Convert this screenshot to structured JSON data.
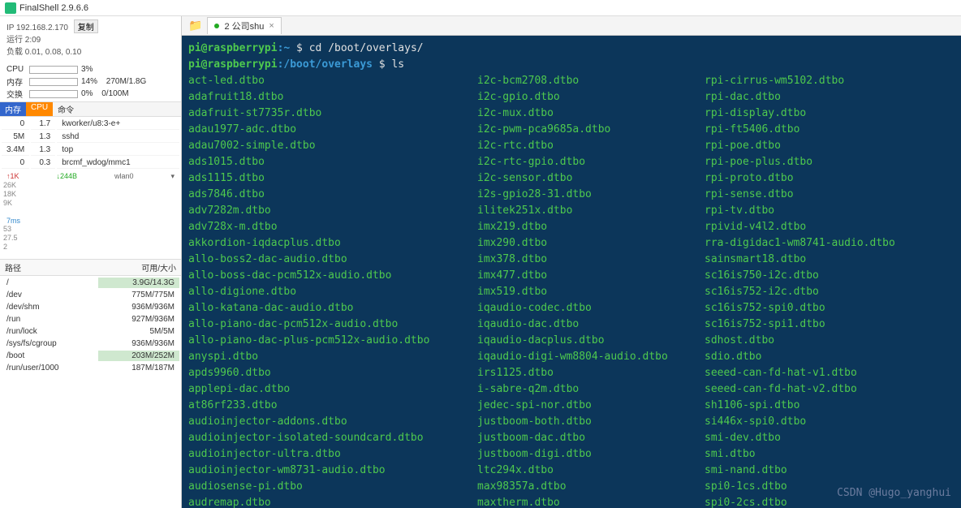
{
  "app": {
    "title": "FinalShell 2.9.6.6"
  },
  "sidebar": {
    "ip_line": "IP 192.168.2.170",
    "copy_label": "复制",
    "run_line": "运行 2:09",
    "load_line": "负载 0.01, 0.08, 0.10",
    "gauges": {
      "cpu_label": "CPU",
      "cpu_pct": "3%",
      "cpu_fill": 3,
      "mem_label": "内存",
      "mem_pct": "14%",
      "mem_text": "270M/1.8G",
      "mem_fill": 14,
      "swap_label": "交换",
      "swap_pct": "0%",
      "swap_text": "0/100M",
      "swap_fill": 0
    },
    "proc_headers": [
      "内存",
      "CPU",
      "命令"
    ],
    "procs": [
      {
        "mem": "0",
        "cpu": "1.7",
        "cmd": "kworker/u8:3-e+"
      },
      {
        "mem": "5M",
        "cpu": "1.3",
        "cmd": "sshd"
      },
      {
        "mem": "3.4M",
        "cpu": "1.3",
        "cmd": "top"
      },
      {
        "mem": "0",
        "cpu": "0.3",
        "cmd": "brcmf_wdog/mmc1"
      }
    ],
    "chart1": {
      "up": "↑1K",
      "down": "↓244B",
      "iface": "wlan0",
      "y": [
        "26K",
        "18K",
        "9K"
      ]
    },
    "chart2": {
      "top": "7ms",
      "y": [
        "53",
        "27.5",
        "2"
      ]
    },
    "fs_header": {
      "path": "路径",
      "size": "可用/大小"
    },
    "fs": [
      {
        "p": "/",
        "s": "3.9G/14.3G",
        "hl": true
      },
      {
        "p": "/dev",
        "s": "775M/775M"
      },
      {
        "p": "/dev/shm",
        "s": "936M/936M"
      },
      {
        "p": "/run",
        "s": "927M/936M"
      },
      {
        "p": "/run/lock",
        "s": "5M/5M"
      },
      {
        "p": "/sys/fs/cgroup",
        "s": "936M/936M"
      },
      {
        "p": "/boot",
        "s": "203M/252M",
        "hl": true
      },
      {
        "p": "/run/user/1000",
        "s": "187M/187M"
      }
    ]
  },
  "tab": {
    "label": "2 公司shu"
  },
  "terminal": {
    "p1_user": "pi@raspberrypi",
    "p1_sep": ":",
    "p1_path": "~",
    "p1_dollar": " $ ",
    "p1_cmd": "cd /boot/overlays/",
    "p2_user": "pi@raspberrypi",
    "p2_sep": ":",
    "p2_path": "/boot/overlays",
    "p2_dollar": " $ ",
    "p2_cmd": "ls",
    "col1": [
      "act-led.dtbo",
      "adafruit18.dtbo",
      "adafruit-st7735r.dtbo",
      "adau1977-adc.dtbo",
      "adau7002-simple.dtbo",
      "ads1015.dtbo",
      "ads1115.dtbo",
      "ads7846.dtbo",
      "adv7282m.dtbo",
      "adv728x-m.dtbo",
      "akkordion-iqdacplus.dtbo",
      "allo-boss2-dac-audio.dtbo",
      "allo-boss-dac-pcm512x-audio.dtbo",
      "allo-digione.dtbo",
      "allo-katana-dac-audio.dtbo",
      "allo-piano-dac-pcm512x-audio.dtbo",
      "allo-piano-dac-plus-pcm512x-audio.dtbo",
      "anyspi.dtbo",
      "apds9960.dtbo",
      "applepi-dac.dtbo",
      "at86rf233.dtbo",
      "audioinjector-addons.dtbo",
      "audioinjector-isolated-soundcard.dtbo",
      "audioinjector-ultra.dtbo",
      "audioinjector-wm8731-audio.dtbo",
      "audiosense-pi.dtbo",
      "audremap.dtbo"
    ],
    "col2": [
      "i2c-bcm2708.dtbo",
      "i2c-gpio.dtbo",
      "i2c-mux.dtbo",
      "i2c-pwm-pca9685a.dtbo",
      "i2c-rtc.dtbo",
      "i2c-rtc-gpio.dtbo",
      "i2c-sensor.dtbo",
      "i2s-gpio28-31.dtbo",
      "ilitek251x.dtbo",
      "imx219.dtbo",
      "imx290.dtbo",
      "imx378.dtbo",
      "imx477.dtbo",
      "imx519.dtbo",
      "iqaudio-codec.dtbo",
      "iqaudio-dac.dtbo",
      "iqaudio-dacplus.dtbo",
      "iqaudio-digi-wm8804-audio.dtbo",
      "irs1125.dtbo",
      "i-sabre-q2m.dtbo",
      "jedec-spi-nor.dtbo",
      "justboom-both.dtbo",
      "justboom-dac.dtbo",
      "justboom-digi.dtbo",
      "ltc294x.dtbo",
      "max98357a.dtbo",
      "maxtherm.dtbo"
    ],
    "col3": [
      "rpi-cirrus-wm5102.dtbo",
      "rpi-dac.dtbo",
      "rpi-display.dtbo",
      "rpi-ft5406.dtbo",
      "rpi-poe.dtbo",
      "rpi-poe-plus.dtbo",
      "rpi-proto.dtbo",
      "rpi-sense.dtbo",
      "rpi-tv.dtbo",
      "rpivid-v4l2.dtbo",
      "rra-digidac1-wm8741-audio.dtbo",
      "sainsmart18.dtbo",
      "sc16is750-i2c.dtbo",
      "sc16is752-i2c.dtbo",
      "sc16is752-spi0.dtbo",
      "sc16is752-spi1.dtbo",
      "sdhost.dtbo",
      "sdio.dtbo",
      "seeed-can-fd-hat-v1.dtbo",
      "seeed-can-fd-hat-v2.dtbo",
      "sh1106-spi.dtbo",
      "si446x-spi0.dtbo",
      "smi-dev.dtbo",
      "smi.dtbo",
      "smi-nand.dtbo",
      "spi0-1cs.dtbo",
      "spi0-2cs.dtbo"
    ]
  },
  "watermark": "CSDN @Hugo_yanghui"
}
